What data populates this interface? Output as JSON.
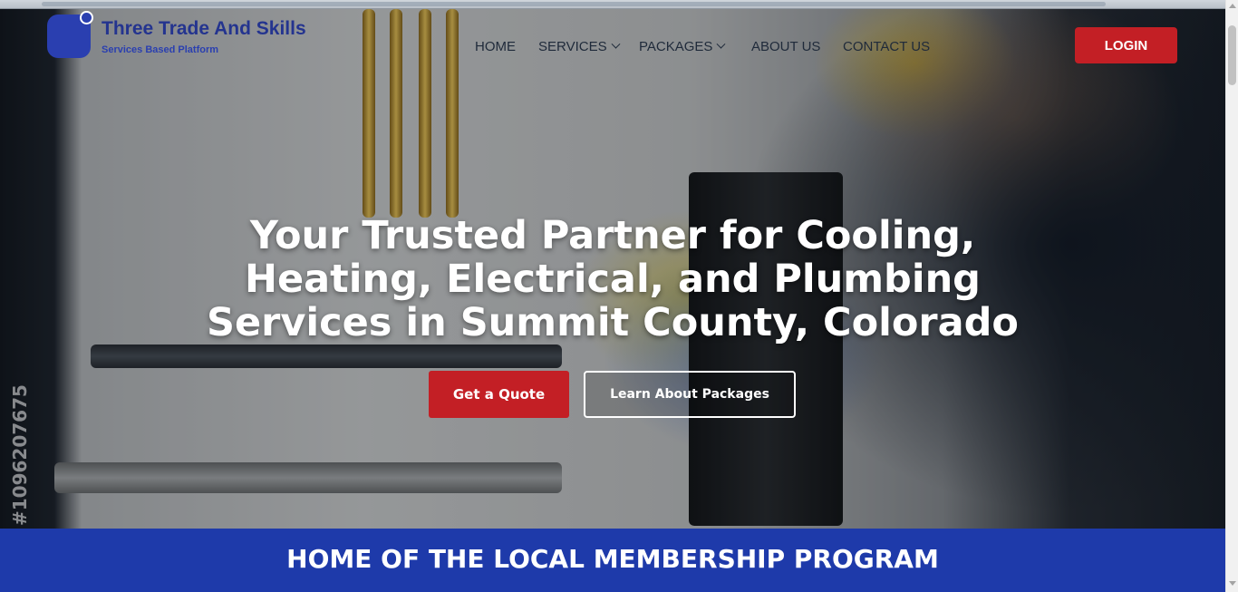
{
  "brand": {
    "name": "Three Trade And Skills",
    "tagline": "Services Based Platform"
  },
  "nav": {
    "items": [
      {
        "label": "HOME",
        "has_dropdown": false
      },
      {
        "label": "SERVICES",
        "has_dropdown": true
      },
      {
        "label": "PACKAGES",
        "has_dropdown": true
      },
      {
        "label": "ABOUT US",
        "has_dropdown": false
      },
      {
        "label": "CONTACT US",
        "has_dropdown": false
      }
    ],
    "login_label": "LOGIN"
  },
  "hero": {
    "title": "Your Trusted Partner for Cooling, Heating, Electrical, and Plumbing Services in Summit County, Colorado",
    "primary_cta": "Get a Quote",
    "secondary_cta": "Learn About Packages",
    "watermark_text": "#1096207675"
  },
  "banner": {
    "title": "HOME OF THE LOCAL MEMBERSHIP PROGRAM"
  },
  "colors": {
    "accent_red": "#c31f25",
    "brand_blue": "#2a3fb0",
    "banner_blue": "#1e3aaa"
  }
}
